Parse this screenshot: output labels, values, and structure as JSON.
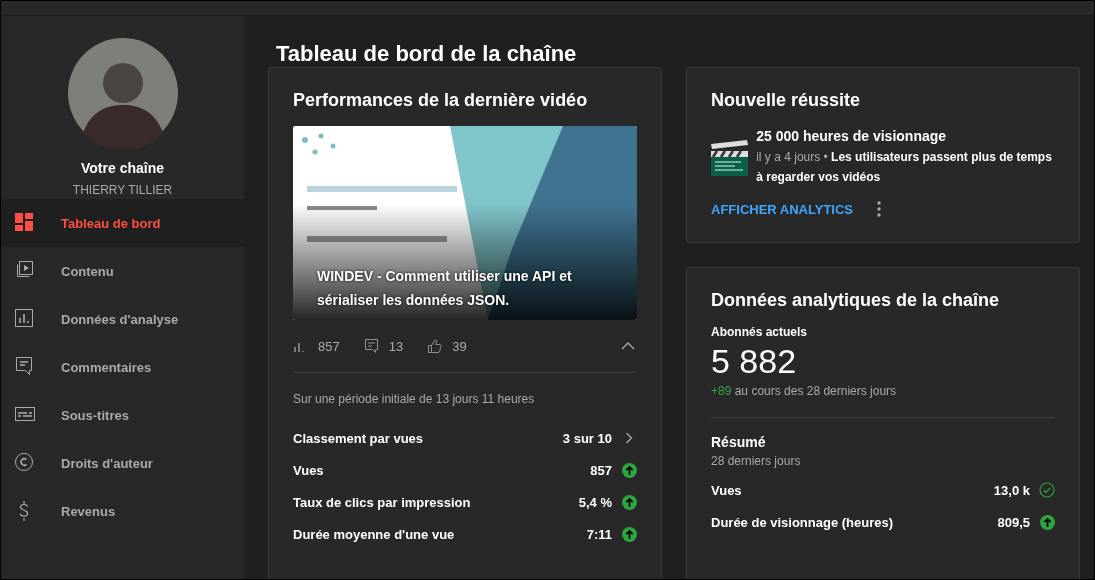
{
  "sidebar": {
    "channel_label": "Votre chaîne",
    "channel_name": "THIERRY TILLIER",
    "items": [
      {
        "label": "Tableau de bord",
        "kind": "dashboard",
        "selected": true
      },
      {
        "label": "Contenu",
        "kind": "content",
        "selected": false
      },
      {
        "label": "Données d'analyse",
        "kind": "analytics",
        "selected": false
      },
      {
        "label": "Commentaires",
        "kind": "comments",
        "selected": false
      },
      {
        "label": "Sous-titres",
        "kind": "subtitles",
        "selected": false
      },
      {
        "label": "Droits d'auteur",
        "kind": "copyright",
        "selected": false
      },
      {
        "label": "Revenus",
        "kind": "money",
        "selected": false
      }
    ]
  },
  "page_title": "Tableau de bord de la chaîne",
  "latest_video": {
    "title": "Performances de la dernière vidéo",
    "video_title": "WINDEV - Comment utiliser une API et sérialiser les données JSON.",
    "stats": [
      {
        "kind": "views",
        "value": "857"
      },
      {
        "kind": "comments",
        "value": "13"
      },
      {
        "kind": "likes",
        "value": "39"
      }
    ],
    "expanded": true,
    "period": "Sur une période initiale de 13 jours 11 heures",
    "metrics": [
      {
        "label": "Classement par vues",
        "value": "3 sur 10",
        "kind": "chevron"
      },
      {
        "label": "Vues",
        "value": "857",
        "kind": "up"
      },
      {
        "label": "Taux de clics par impression",
        "value": "5,4 %",
        "kind": "up"
      },
      {
        "label": "Durée moyenne d'une vue",
        "value": "7:11",
        "kind": "up"
      }
    ]
  },
  "achievement": {
    "title": "Nouvelle réussite",
    "headline": "25 000 heures de visionnage",
    "time": "il y a 4 jours",
    "separator": "•",
    "description": "Les utilisateurs passent plus de temps à regarder vos vidéos",
    "action": "AFFICHER ANALYTICS"
  },
  "analytics": {
    "title": "Données analytiques de la chaîne",
    "subscribers_label": "Abonnés actuels",
    "subscribers": "5 882",
    "change": "+89",
    "change_text": "au cours des 28 derniers jours",
    "summary_title": "Résumé",
    "summary_period": "28 derniers jours",
    "metrics": [
      {
        "label": "Vues",
        "value": "13,0 k",
        "kind": "check"
      },
      {
        "label": "Durée de visionnage (heures)",
        "value": "809,5",
        "kind": "up"
      }
    ]
  }
}
